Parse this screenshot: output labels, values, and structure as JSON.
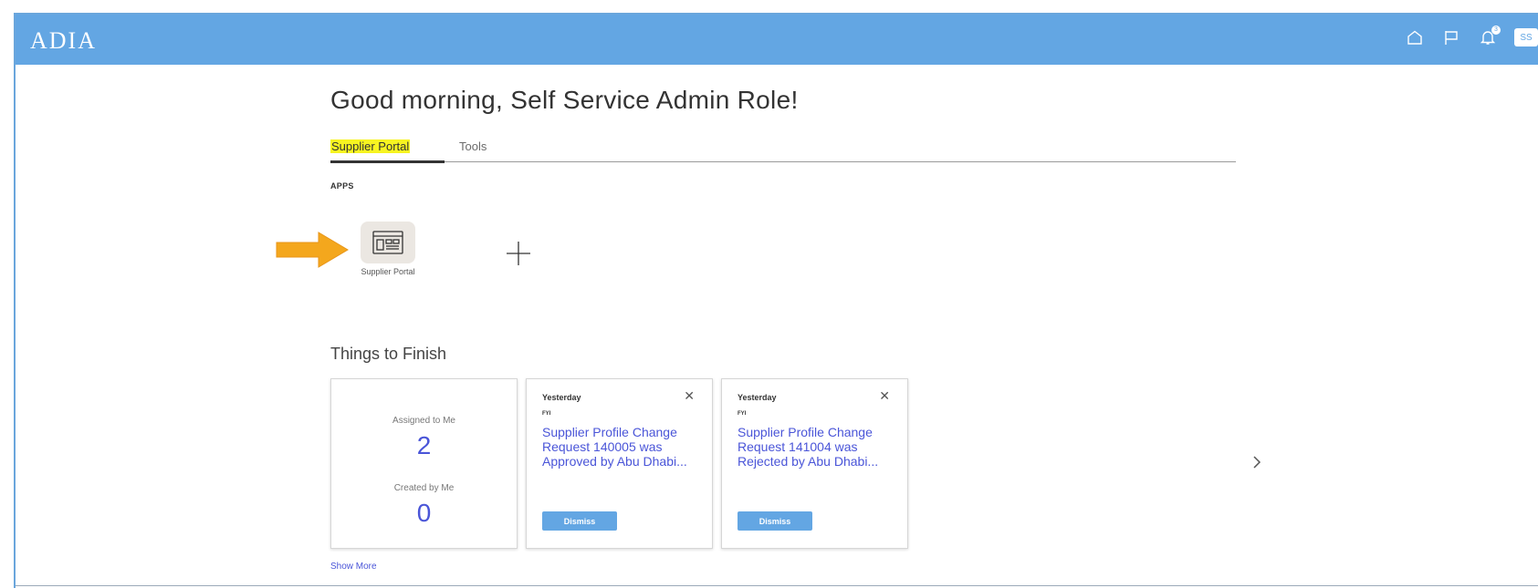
{
  "header": {
    "logo": "ADIA",
    "icons": [
      "home-icon",
      "flag-icon",
      "notification-bell-icon"
    ],
    "notification_count": "3",
    "avatar_initials": "SS",
    "colors": {
      "bar": "#63a6e3"
    }
  },
  "greeting": "Good morning, Self Service Admin Role!",
  "tabs": [
    {
      "label": "Supplier Portal",
      "active": true
    },
    {
      "label": "Tools",
      "active": false
    }
  ],
  "apps": {
    "section_label": "APPS",
    "items": [
      {
        "label": "Supplier Portal",
        "icon": "supplier-portal-icon"
      }
    ],
    "add_icon": "plus-icon"
  },
  "things_to_finish": {
    "title": "Things to Finish",
    "summary": {
      "assigned_label": "Assigned to Me",
      "assigned_count": "2",
      "created_label": "Created by Me",
      "created_count": "0"
    },
    "notifications": [
      {
        "date": "Yesterday",
        "type": "FYI",
        "text": "Supplier Profile Change Request 140005 was Approved by Abu Dhabi...",
        "action": "Dismiss"
      },
      {
        "date": "Yesterday",
        "type": "FYI",
        "text": "Supplier Profile Change Request 141004 was Rejected by Abu Dhabi...",
        "action": "Dismiss"
      }
    ],
    "show_more": "Show More"
  },
  "annotation": {
    "arrow_color": "#f4a71d",
    "highlight_color": "#f7f421"
  }
}
